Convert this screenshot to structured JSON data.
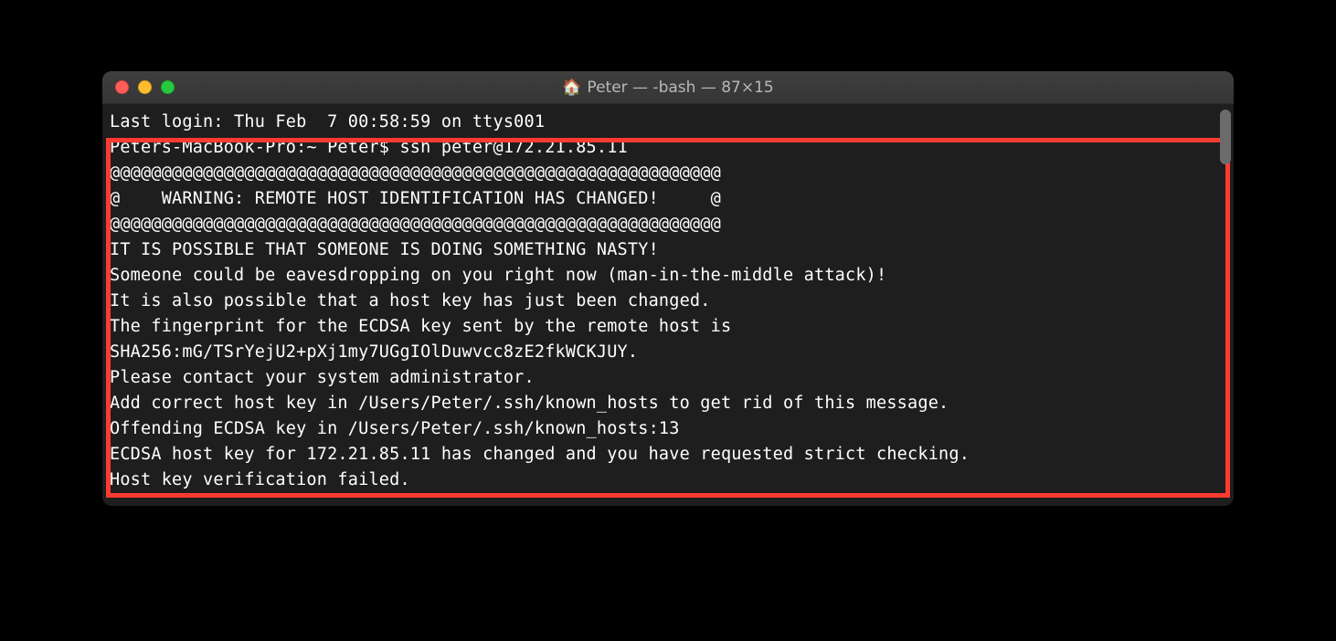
{
  "window": {
    "title_icon": "🏠",
    "title": "Peter — -bash — 87×15"
  },
  "terminal": {
    "lines": [
      "Last login: Thu Feb  7 00:58:59 on ttys001",
      "Peters-MacBook-Pro:~ Peter$ ssh peter@172.21.85.11",
      "@@@@@@@@@@@@@@@@@@@@@@@@@@@@@@@@@@@@@@@@@@@@@@@@@@@@@@@@@@@",
      "@    WARNING: REMOTE HOST IDENTIFICATION HAS CHANGED!     @",
      "@@@@@@@@@@@@@@@@@@@@@@@@@@@@@@@@@@@@@@@@@@@@@@@@@@@@@@@@@@@",
      "IT IS POSSIBLE THAT SOMEONE IS DOING SOMETHING NASTY!",
      "Someone could be eavesdropping on you right now (man-in-the-middle attack)!",
      "It is also possible that a host key has just been changed.",
      "The fingerprint for the ECDSA key sent by the remote host is",
      "SHA256:mG/TSrYejU2+pXj1my7UGgIOlDuwvcc8zE2fkWCKJUY.",
      "Please contact your system administrator.",
      "Add correct host key in /Users/Peter/.ssh/known_hosts to get rid of this message.",
      "Offending ECDSA key in /Users/Peter/.ssh/known_hosts:13",
      "ECDSA host key for 172.21.85.11 has changed and you have requested strict checking.",
      "Host key verification failed."
    ]
  }
}
